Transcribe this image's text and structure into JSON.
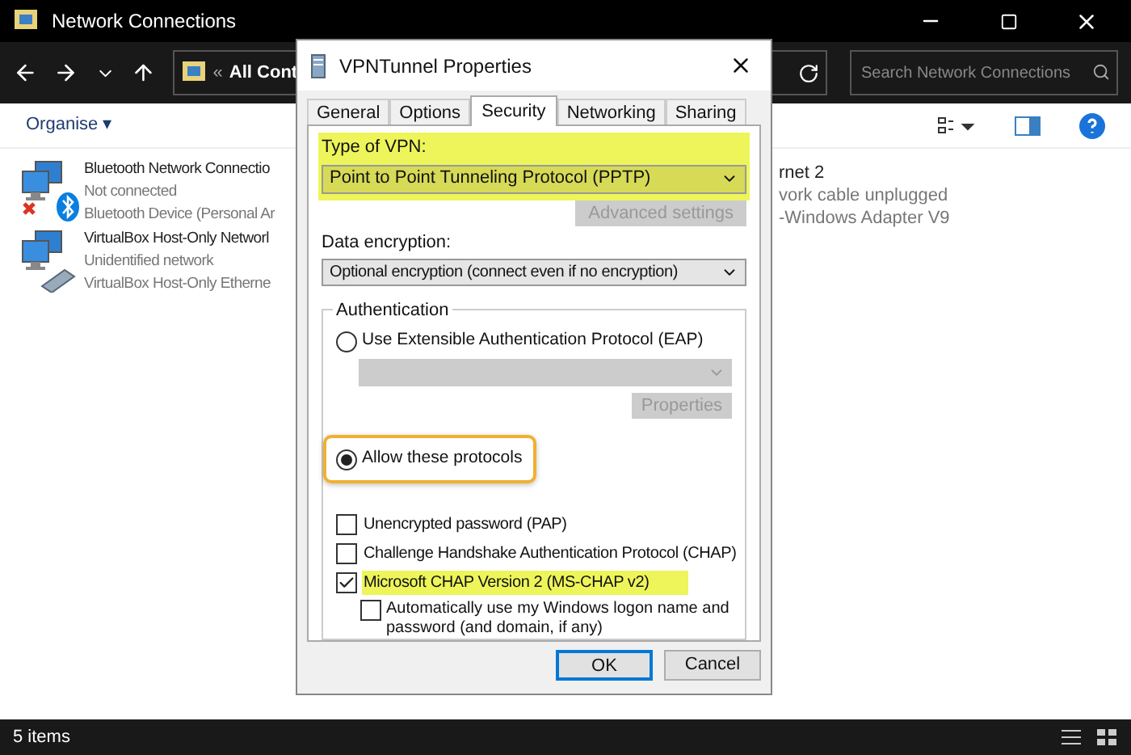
{
  "window": {
    "title": "Network Connections"
  },
  "address_bar": {
    "prefix": "«",
    "path": "All Cont"
  },
  "search": {
    "placeholder": "Search Network Connections"
  },
  "command_bar": {
    "organise": "Organise ▾"
  },
  "connections": [
    {
      "name": "Bluetooth Network Connectio",
      "status": "Not connected",
      "device": "Bluetooth Device (Personal Ar",
      "kind": "bluetooth"
    },
    {
      "name": "VirtualBox Host-Only Networl",
      "status": "Unidentified network",
      "device": "VirtualBox Host-Only Etherne",
      "kind": "ethernet"
    },
    {
      "name": "rnet 2",
      "status": "vork cable unplugged",
      "device": "-Windows Adapter V9",
      "kind": "hidden"
    }
  ],
  "status_bar": {
    "count": "5 items"
  },
  "dialog": {
    "title": "VPNTunnel Properties",
    "tabs": [
      {
        "label": "General",
        "selected": false
      },
      {
        "label": "Options",
        "selected": false
      },
      {
        "label": "Security",
        "selected": true
      },
      {
        "label": "Networking",
        "selected": false
      },
      {
        "label": "Sharing",
        "selected": false
      }
    ],
    "vpn_type": {
      "label": "Type of VPN:",
      "value": "Point to Point Tunneling Protocol (PPTP)",
      "highlighted": true
    },
    "advanced_button": {
      "label": "Advanced settings",
      "disabled": true
    },
    "encryption": {
      "label": "Data encryption:",
      "value": "Optional encryption (connect even if no encryption)"
    },
    "authentication": {
      "title": "Authentication",
      "eap": {
        "label": "Use Extensible Authentication Protocol (EAP)",
        "selected": false
      },
      "eap_properties": {
        "label": "Properties",
        "disabled": true
      },
      "allow": {
        "label": "Allow these protocols",
        "selected": true,
        "highlighted": true
      },
      "protocols": [
        {
          "label": "Unencrypted password (PAP)",
          "checked": false,
          "highlighted": false
        },
        {
          "label": "Challenge Handshake Authentication Protocol (CHAP)",
          "checked": false,
          "highlighted": false
        },
        {
          "label": "Microsoft CHAP Version 2 (MS-CHAP v2)",
          "checked": true,
          "highlighted": true
        }
      ],
      "auto_logon": {
        "label": "Automatically use my Windows logon name and password (and domain, if any)",
        "checked": false
      }
    },
    "buttons": [
      {
        "label": "OK",
        "default": true
      },
      {
        "label": "Cancel",
        "default": false
      }
    ]
  }
}
